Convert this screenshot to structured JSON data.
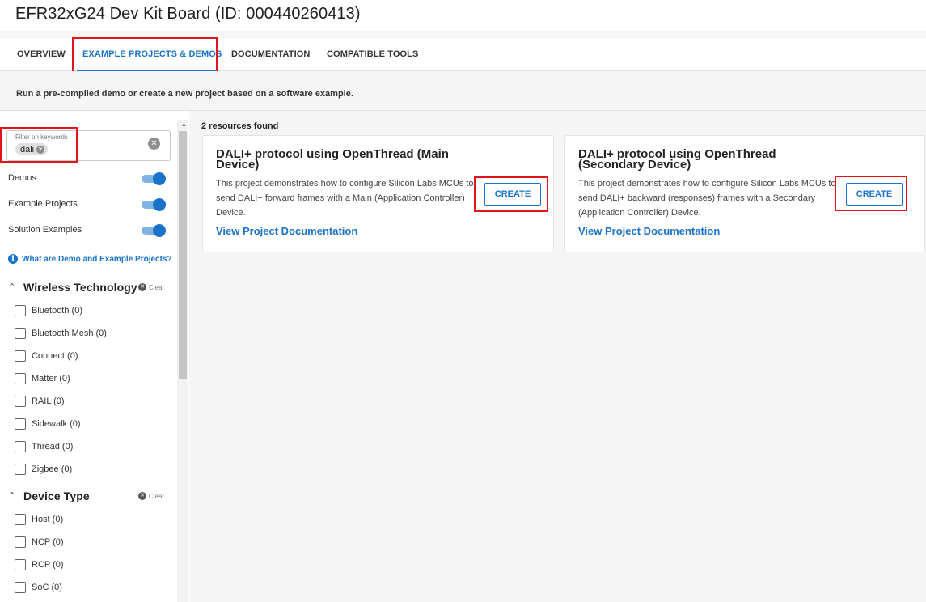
{
  "page_title": "EFR32xG24 Dev Kit Board (ID: 000440260413)",
  "tabs": [
    {
      "label": "OVERVIEW",
      "active": false
    },
    {
      "label": "EXAMPLE PROJECTS & DEMOS",
      "active": true
    },
    {
      "label": "DOCUMENTATION",
      "active": false
    },
    {
      "label": "COMPATIBLE TOOLS",
      "active": false
    }
  ],
  "subtitle": "Run a pre-compiled demo or create a new project based on a software example.",
  "filter": {
    "label": "Filter on keywords",
    "chip": "dali"
  },
  "toggles": [
    {
      "label": "Demos",
      "on": true
    },
    {
      "label": "Example Projects",
      "on": true
    },
    {
      "label": "Solution Examples",
      "on": true
    }
  ],
  "info_link": "What are Demo and Example Projects?",
  "sections": [
    {
      "title": "Wireless Technology",
      "clear_label": "Clear",
      "items": [
        "Bluetooth (0)",
        "Bluetooth Mesh (0)",
        "Connect (0)",
        "Matter (0)",
        "RAIL (0)",
        "Sidewalk (0)",
        "Thread (0)",
        "Zigbee (0)"
      ]
    },
    {
      "title": "Device Type",
      "clear_label": "Clear",
      "items": [
        "Host (0)",
        "NCP (0)",
        "RCP (0)",
        "SoC (0)"
      ]
    }
  ],
  "results": {
    "count_text": "2 resources found",
    "cards": [
      {
        "title": "DALI+ protocol using OpenThread (Main Device)",
        "description": "This project demonstrates how to configure Silicon Labs MCUs to send DALI+ forward frames with a Main (Application Controller) Device.",
        "button": "CREATE",
        "link": "View Project Documentation"
      },
      {
        "title": "DALI+ protocol using OpenThread (Secondary Device)",
        "description": "This project demonstrates how to configure Silicon Labs MCUs to send DALI+ backward (responses) frames with a Secondary (Application Controller) Device.",
        "button": "CREATE",
        "link": "View Project Documentation"
      }
    ]
  },
  "colors": {
    "accent": "#1a73c8",
    "highlight": "#e0141d"
  }
}
